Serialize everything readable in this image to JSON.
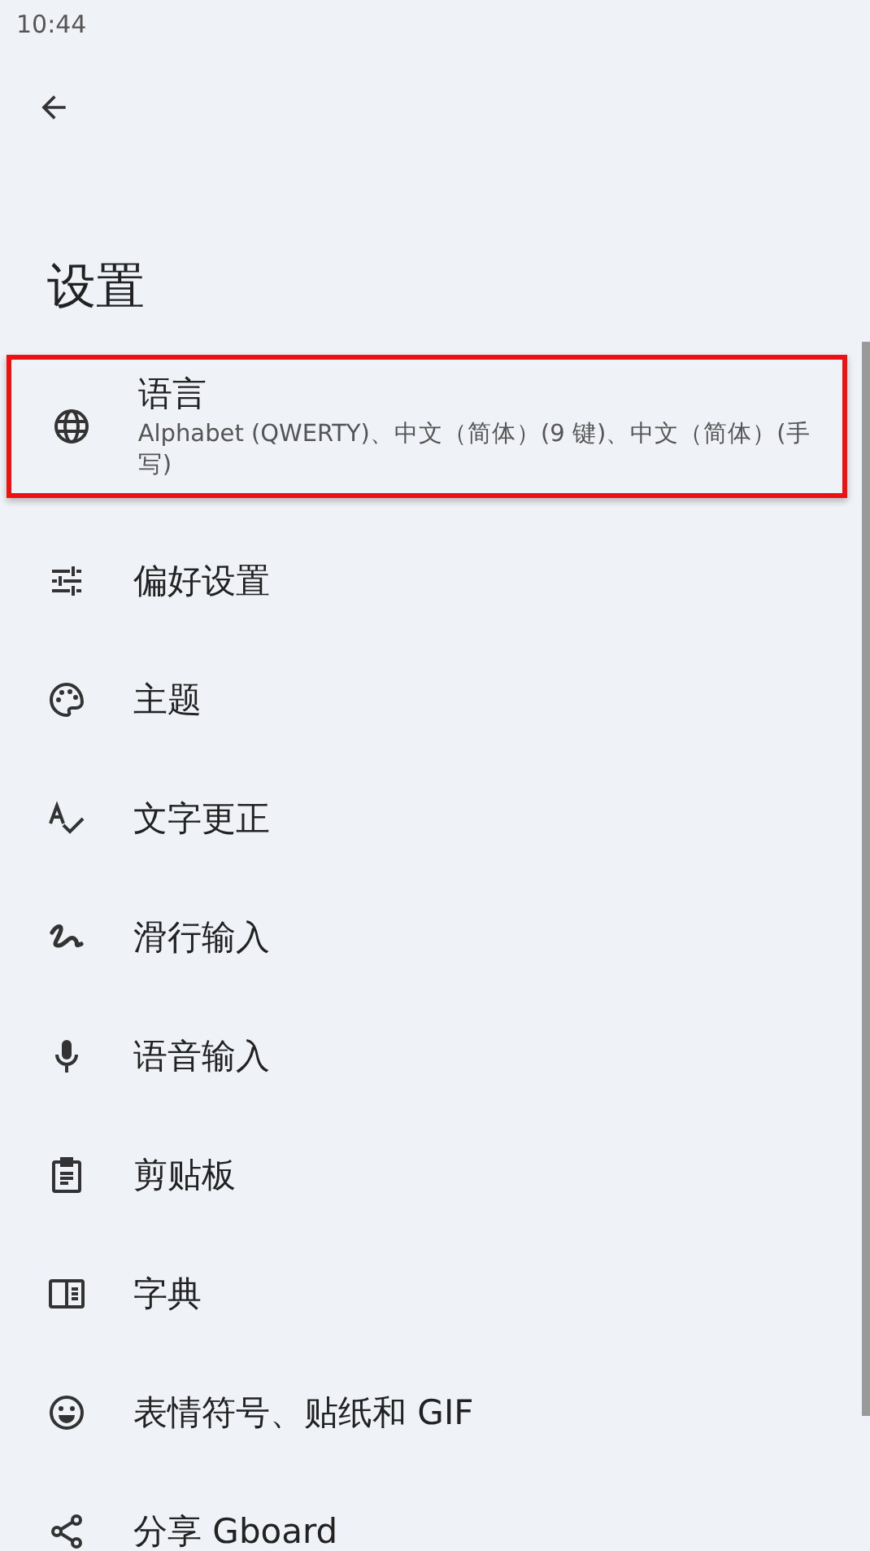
{
  "status_bar": {
    "time": "10:44"
  },
  "title": "设置",
  "items": [
    {
      "label": "语言",
      "summary": "Alphabet (QWERTY)、中文（简体）(9 键)、中文（简体）(手写)",
      "selected": true
    },
    {
      "label": "偏好设置",
      "selected": false
    },
    {
      "label": "主题",
      "selected": false
    },
    {
      "label": "文字更正",
      "selected": false
    },
    {
      "label": "滑行输入",
      "selected": false
    },
    {
      "label": "语音输入",
      "selected": false
    },
    {
      "label": "剪贴板",
      "selected": false
    },
    {
      "label": "字典",
      "selected": false
    },
    {
      "label": "表情符号、贴纸和 GIF",
      "selected": false
    },
    {
      "label": "分享 Gboard",
      "selected": false
    }
  ]
}
